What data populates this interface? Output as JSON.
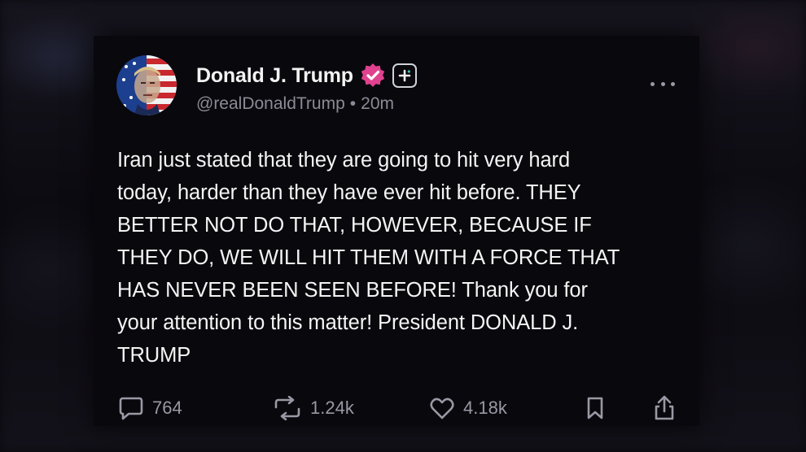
{
  "post": {
    "display_name": "Donald J. Trump",
    "handle": "@realDonaldTrump",
    "separator": "•",
    "time": "20m",
    "body": "Iran just stated that they are going to hit very hard\ntoday, harder than they have ever hit before. THEY\nBETTER NOT DO THAT, HOWEVER, BECAUSE IF\nTHEY DO, WE WILL HIT THEM WITH A FORCE THAT\nHAS NEVER BEEN SEEN BEFORE! Thank you for\nyour attention to this matter! President DONALD J.\nTRUMP",
    "verified_color": "#e0428f",
    "icons": {
      "avatar": "avatar-flag-portrait",
      "verified": "verified-badge-icon",
      "follow": "plus-icon",
      "more": "more-icon"
    }
  },
  "actions": {
    "replies": "764",
    "reposts": "1.24k",
    "likes": "4.18k",
    "icons": [
      "reply-icon",
      "repost-icon",
      "like-icon",
      "bookmark-icon",
      "share-icon"
    ]
  },
  "colors": {
    "background": "#09080d",
    "text": "#f4f4f4",
    "muted": "#8c8a95"
  }
}
